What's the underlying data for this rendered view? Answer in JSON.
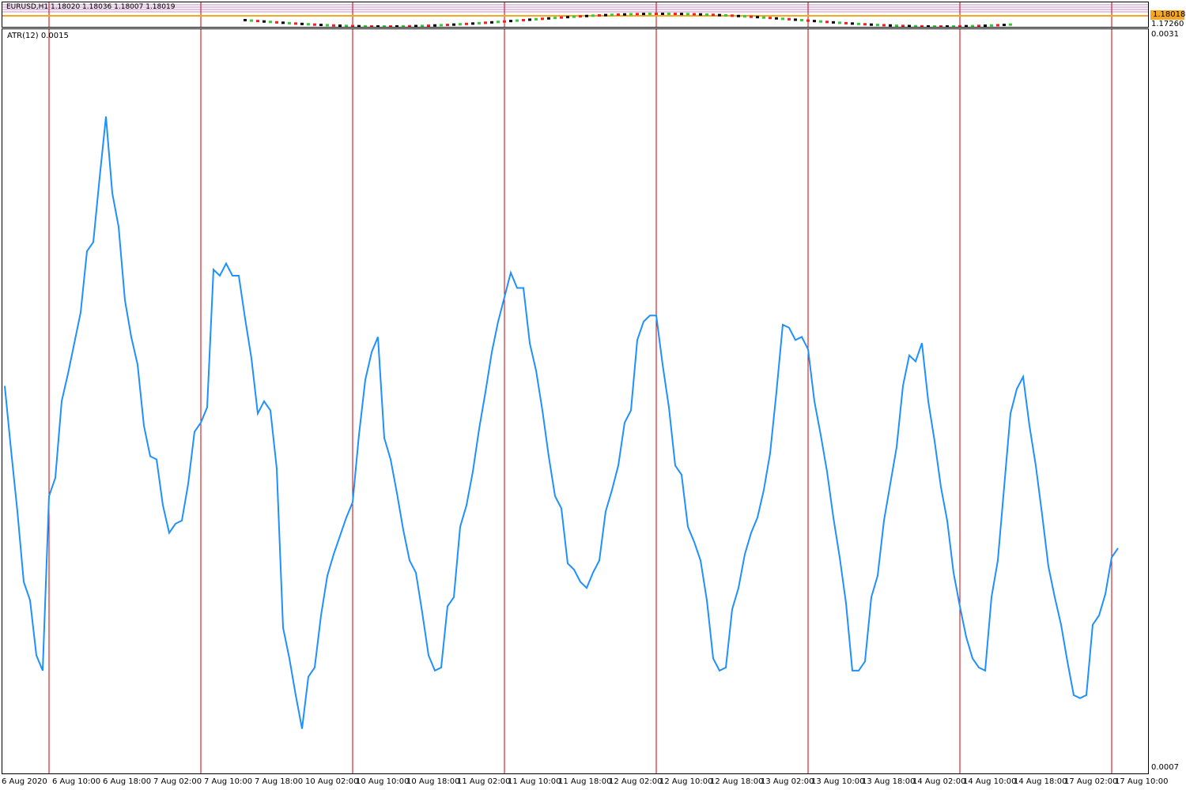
{
  "price_panel": {
    "symbol_text": "EURUSD,H1  1.18020  1.18036  1.18007  1.18019",
    "price_tag_1": "1.18018",
    "price_tag_1_color": "#f5a623",
    "axis_low": "1.17260",
    "axis_top": ""
  },
  "atr_panel": {
    "label": "ATR(12) 0.0015",
    "axis_max": "0.0031",
    "axis_min": "0.0007",
    "line_color": "#1e90ff",
    "separator_color": "#cc0000"
  },
  "x_ticks": [
    "6 Aug 2020",
    "6 Aug 10:00",
    "6 Aug 18:00",
    "7 Aug 02:00",
    "7 Aug 10:00",
    "7 Aug 18:00",
    "10 Aug 02:00",
    "10 Aug 10:00",
    "10 Aug 18:00",
    "11 Aug 02:00",
    "11 Aug 10:00",
    "11 Aug 18:00",
    "12 Aug 02:00",
    "12 Aug 10:00",
    "12 Aug 18:00",
    "13 Aug 02:00",
    "13 Aug 10:00",
    "13 Aug 18:00",
    "14 Aug 02:00",
    "14 Aug 10:00",
    "14 Aug 18:00",
    "17 Aug 02:00",
    "17 Aug 10:00"
  ],
  "chart_data": {
    "type": "line",
    "title": "ATR(12) 0.0015",
    "ylim": [
      0.0007,
      0.0031
    ],
    "day_separators": [
      "6 Aug 10:00",
      "7 Aug 10:00",
      "10 Aug 10:00",
      "11 Aug 10:00",
      "12 Aug 10:00",
      "13 Aug 10:00",
      "14 Aug 10:00",
      "17 Aug 10:00"
    ],
    "series": [
      {
        "values": [
          0.00194,
          0.00173,
          0.00153,
          0.0013,
          0.00124,
          0.00106,
          0.00101,
          0.00158,
          0.00164,
          0.00189,
          0.00198,
          0.00208,
          0.00218,
          0.00238,
          0.00241,
          0.00262,
          0.00282,
          0.00257,
          0.00246,
          0.00222,
          0.0021,
          0.00201,
          0.00181,
          0.00171,
          0.0017,
          0.00155,
          0.00146,
          0.00149,
          0.0015,
          0.00162,
          0.00179,
          0.00182,
          0.00187,
          0.00232,
          0.0023,
          0.00234,
          0.0023,
          0.0023,
          0.00216,
          0.00203,
          0.00185,
          0.00189,
          0.00186,
          0.00167,
          0.00115,
          0.00105,
          0.00093,
          0.00082,
          0.00099,
          0.00102,
          0.00119,
          0.00132,
          0.00139,
          0.00145,
          0.00151,
          0.00156,
          0.00178,
          0.00196,
          0.00205,
          0.0021,
          0.00177,
          0.0017,
          0.00159,
          0.00147,
          0.00137,
          0.00133,
          0.0012,
          0.00106,
          0.00101,
          0.00102,
          0.00122,
          0.00125,
          0.00148,
          0.00155,
          0.00166,
          0.0018,
          0.00192,
          0.00205,
          0.00215,
          0.00223,
          0.00231,
          0.00226,
          0.00226,
          0.00208,
          0.00199,
          0.00186,
          0.00171,
          0.00158,
          0.00154,
          0.00136,
          0.00134,
          0.0013,
          0.00128,
          0.00133,
          0.00137,
          0.00153,
          0.0016,
          0.00168,
          0.00182,
          0.00186,
          0.00209,
          0.00215,
          0.00217,
          0.00217,
          0.00201,
          0.00187,
          0.00168,
          0.00165,
          0.00148,
          0.00143,
          0.00137,
          0.00124,
          0.00105,
          0.00101,
          0.00102,
          0.00121,
          0.00128,
          0.00139,
          0.00146,
          0.00151,
          0.0016,
          0.00172,
          0.00192,
          0.00214,
          0.00213,
          0.00209,
          0.0021,
          0.00206,
          0.00189,
          0.00178,
          0.00166,
          0.00151,
          0.00138,
          0.00123,
          0.00101,
          0.00101,
          0.00104,
          0.00125,
          0.00132,
          0.0015,
          0.00162,
          0.00174,
          0.00194,
          0.00204,
          0.00202,
          0.00208,
          0.00189,
          0.00176,
          0.00161,
          0.0015,
          0.00133,
          0.00122,
          0.00112,
          0.00105,
          0.00102,
          0.00101,
          0.00125,
          0.00137,
          0.00161,
          0.00185,
          0.00193,
          0.00197,
          0.00181,
          0.00168,
          0.00152,
          0.00135,
          0.00125,
          0.00116,
          0.00104,
          0.00093,
          0.00092,
          0.00093,
          0.00116,
          0.00119,
          0.00126,
          0.00138,
          0.00141
        ]
      }
    ]
  }
}
